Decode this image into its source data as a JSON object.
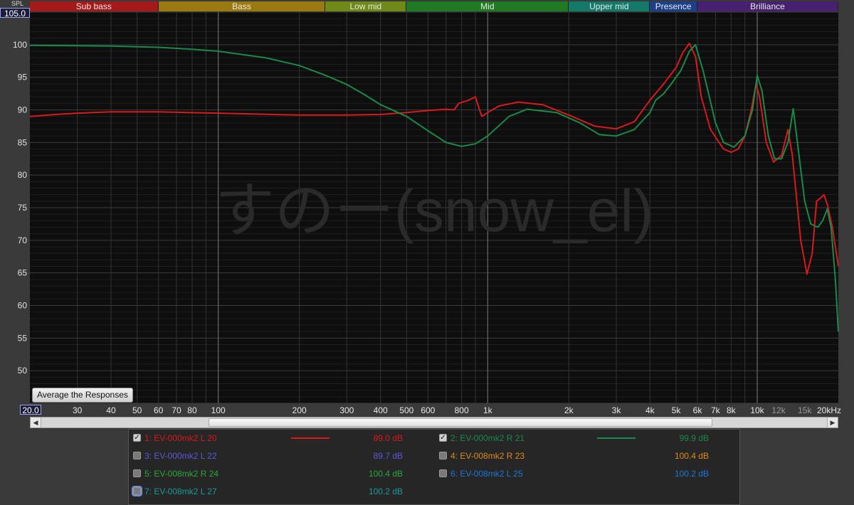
{
  "bands": [
    {
      "label": "Sub bass",
      "from": 20,
      "to": 60,
      "color": "#a41a1a"
    },
    {
      "label": "Bass",
      "from": 60,
      "to": 250,
      "color": "#9a7a10"
    },
    {
      "label": "Low mid",
      "from": 250,
      "to": 500,
      "color": "#6f8a16"
    },
    {
      "label": "Mid",
      "from": 500,
      "to": 2000,
      "color": "#1f7a24"
    },
    {
      "label": "Upper mid",
      "from": 2000,
      "to": 4000,
      "color": "#137a6a"
    },
    {
      "label": "Presence",
      "from": 4000,
      "to": 6000,
      "color": "#1d3f8a"
    },
    {
      "label": "Brilliance",
      "from": 6000,
      "to": 20000,
      "color": "#472070"
    }
  ],
  "axis": {
    "spl_label": "SPL",
    "ymax_label": "105.0",
    "xmin_label": "20.0"
  },
  "average_button": "Average the Responses",
  "watermark": "すのー(snow_el)",
  "legend": [
    {
      "label": "1: EV-000mk2 L 20",
      "value": "89.0 dB",
      "color": "#d81a1a",
      "checked": true,
      "line": true
    },
    {
      "label": "2: EV-000mk2 R 21",
      "value": "99.9 dB",
      "color": "#1a8a4a",
      "checked": true,
      "line": true
    },
    {
      "label": "3: EV-000mk2 L 22",
      "value": "89.7 dB",
      "color": "#5a5ad8",
      "checked": false,
      "line": false
    },
    {
      "label": "4: EV-008mk2 R 23",
      "value": "100.4 dB",
      "color": "#e08a1a",
      "checked": false,
      "line": false
    },
    {
      "label": "5: EV-008mk2 R 24",
      "value": "100.4 dB",
      "color": "#2aa83a",
      "checked": false,
      "line": false
    },
    {
      "label": "6: EV-008mk2 L 25",
      "value": "100.2 dB",
      "color": "#1a78d8",
      "checked": false,
      "line": false
    },
    {
      "label": "7: EV-008mk2 L 27",
      "value": "100.2 dB",
      "color": "#1a9a9a",
      "checked": false,
      "line": false,
      "focus": true
    }
  ],
  "chart_data": {
    "type": "line",
    "xscale": "log",
    "xlim": [
      20,
      20000
    ],
    "ylim": [
      45,
      105
    ],
    "grid": true,
    "x_ticks": [
      {
        "v": 30,
        "t": "30"
      },
      {
        "v": 40,
        "t": "40"
      },
      {
        "v": 50,
        "t": "50"
      },
      {
        "v": 60,
        "t": "60"
      },
      {
        "v": 70,
        "t": "70"
      },
      {
        "v": 80,
        "t": "80"
      },
      {
        "v": 100,
        "t": "100"
      },
      {
        "v": 200,
        "t": "200"
      },
      {
        "v": 300,
        "t": "300"
      },
      {
        "v": 400,
        "t": "400"
      },
      {
        "v": 500,
        "t": "500"
      },
      {
        "v": 600,
        "t": "600"
      },
      {
        "v": 800,
        "t": "800"
      },
      {
        "v": 1000,
        "t": "1k"
      },
      {
        "v": 2000,
        "t": "2k"
      },
      {
        "v": 3000,
        "t": "3k"
      },
      {
        "v": 4000,
        "t": "4k"
      },
      {
        "v": 5000,
        "t": "5k"
      },
      {
        "v": 6000,
        "t": "6k"
      },
      {
        "v": 7000,
        "t": "7k"
      },
      {
        "v": 8000,
        "t": "8k"
      },
      {
        "v": 10000,
        "t": "10k"
      },
      {
        "v": 12000,
        "t": "12k",
        "dim": true
      },
      {
        "v": 15000,
        "t": "15k",
        "dim": true
      },
      {
        "v": 20000,
        "t": "20kHz"
      }
    ],
    "y_ticks": [
      50,
      55,
      60,
      65,
      70,
      75,
      80,
      85,
      90,
      95,
      100
    ],
    "series": [
      {
        "color": "#d81a1a",
        "points": [
          [
            20,
            89.0
          ],
          [
            25,
            89.3
          ],
          [
            30,
            89.5
          ],
          [
            40,
            89.7
          ],
          [
            60,
            89.7
          ],
          [
            100,
            89.5
          ],
          [
            200,
            89.2
          ],
          [
            300,
            89.2
          ],
          [
            400,
            89.3
          ],
          [
            500,
            89.6
          ],
          [
            600,
            89.9
          ],
          [
            700,
            90.1
          ],
          [
            750,
            90.0
          ],
          [
            780,
            91.0
          ],
          [
            850,
            91.5
          ],
          [
            900,
            92.0
          ],
          [
            950,
            89.0
          ],
          [
            1000,
            89.6
          ],
          [
            1100,
            90.6
          ],
          [
            1300,
            91.2
          ],
          [
            1600,
            90.8
          ],
          [
            2000,
            89.2
          ],
          [
            2500,
            87.5
          ],
          [
            3000,
            87.1
          ],
          [
            3500,
            88.2
          ],
          [
            4000,
            91.5
          ],
          [
            4500,
            94.0
          ],
          [
            5000,
            96.5
          ],
          [
            5300,
            98.8
          ],
          [
            5600,
            100.2
          ],
          [
            5900,
            98.2
          ],
          [
            6200,
            92.0
          ],
          [
            6700,
            87.0
          ],
          [
            7500,
            84.0
          ],
          [
            8000,
            83.5
          ],
          [
            8500,
            84.0
          ],
          [
            9000,
            86.0
          ],
          [
            9500,
            90.0
          ],
          [
            9900,
            94.0
          ],
          [
            10200,
            92.0
          ],
          [
            10800,
            85.0
          ],
          [
            11500,
            82.0
          ],
          [
            12300,
            83.0
          ],
          [
            13000,
            87.0
          ],
          [
            13500,
            83.0
          ],
          [
            14500,
            70.0
          ],
          [
            15300,
            64.8
          ],
          [
            16000,
            68.0
          ],
          [
            16600,
            76.0
          ],
          [
            17200,
            76.5
          ],
          [
            17700,
            77.0
          ],
          [
            18200,
            75.5
          ],
          [
            19000,
            72.0
          ],
          [
            20000,
            66.0
          ]
        ]
      },
      {
        "color": "#1a8a4a",
        "points": [
          [
            20,
            99.9
          ],
          [
            40,
            99.8
          ],
          [
            60,
            99.6
          ],
          [
            80,
            99.3
          ],
          [
            100,
            99.0
          ],
          [
            150,
            98.0
          ],
          [
            200,
            96.8
          ],
          [
            250,
            95.3
          ],
          [
            300,
            93.9
          ],
          [
            350,
            92.3
          ],
          [
            400,
            90.8
          ],
          [
            500,
            89.0
          ],
          [
            600,
            86.8
          ],
          [
            700,
            85.0
          ],
          [
            800,
            84.4
          ],
          [
            900,
            84.8
          ],
          [
            1000,
            86.0
          ],
          [
            1200,
            89.0
          ],
          [
            1400,
            90.1
          ],
          [
            1800,
            89.6
          ],
          [
            2200,
            88.0
          ],
          [
            2600,
            86.2
          ],
          [
            3000,
            86.0
          ],
          [
            3500,
            87.0
          ],
          [
            4000,
            89.6
          ],
          [
            4200,
            91.5
          ],
          [
            4500,
            92.5
          ],
          [
            4800,
            94.0
          ],
          [
            5200,
            96.0
          ],
          [
            5600,
            99.0
          ],
          [
            5900,
            100.0
          ],
          [
            6300,
            96.0
          ],
          [
            7000,
            88.0
          ],
          [
            7500,
            85.0
          ],
          [
            8200,
            84.3
          ],
          [
            9000,
            86.0
          ],
          [
            9600,
            90.0
          ],
          [
            10000,
            95.3
          ],
          [
            10400,
            93.0
          ],
          [
            11000,
            86.0
          ],
          [
            11600,
            82.5
          ],
          [
            12300,
            82.5
          ],
          [
            13000,
            85.0
          ],
          [
            13600,
            90.2
          ],
          [
            14100,
            85.0
          ],
          [
            15000,
            76.0
          ],
          [
            15800,
            72.5
          ],
          [
            16800,
            72.0
          ],
          [
            17500,
            73.0
          ],
          [
            18200,
            74.8
          ],
          [
            18800,
            72.0
          ],
          [
            19500,
            64.0
          ],
          [
            20000,
            56.0
          ]
        ]
      }
    ]
  }
}
